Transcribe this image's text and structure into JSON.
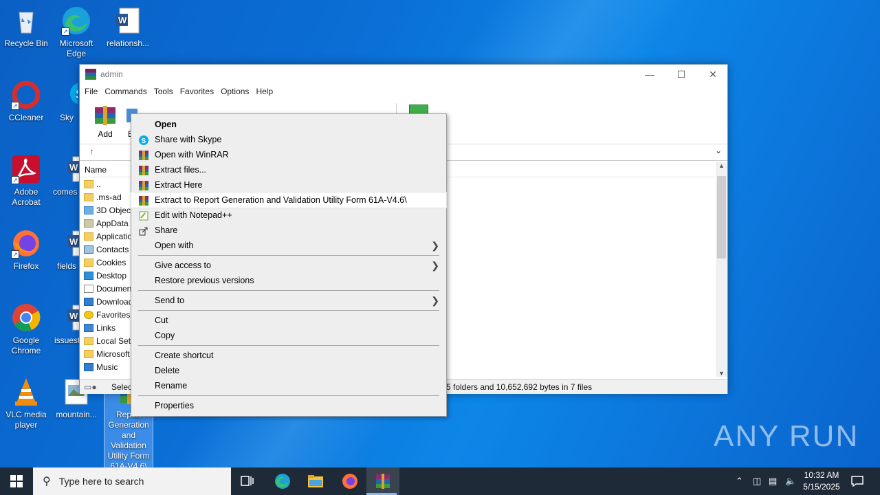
{
  "desktop": {
    "icons": [
      {
        "label": "Recycle Bin",
        "icon": "recycle-bin-icon"
      },
      {
        "label": "Microsoft Edge",
        "icon": "edge-icon"
      },
      {
        "label": "relationsh...",
        "icon": "word-doc-icon"
      },
      {
        "label": "CCleaner",
        "icon": "ccleaner-icon"
      },
      {
        "label": "Sky",
        "icon": "skype-icon"
      },
      {
        "label": "Adobe Acrobat",
        "icon": "acrobat-icon"
      },
      {
        "label": "comes",
        "icon": "word-doc-icon"
      },
      {
        "label": "Firefox",
        "icon": "firefox-icon"
      },
      {
        "label": "fields",
        "icon": "word-doc-icon"
      },
      {
        "label": "Google Chrome",
        "icon": "chrome-icon"
      },
      {
        "label": "issuest",
        "icon": "word-doc-icon"
      },
      {
        "label": "VLC media player",
        "icon": "vlc-icon"
      },
      {
        "label": "mountain...",
        "icon": "image-file-icon"
      },
      {
        "label": "Report Generation and Validation Utility Form 61A-V4.6\\",
        "icon": "rar-archive-icon"
      }
    ]
  },
  "window": {
    "title": "admin",
    "menu": [
      "File",
      "Commands",
      "Tools",
      "Favorites",
      "Options",
      "Help"
    ],
    "toolbar": [
      {
        "label": "Add",
        "icon": "add-archive-icon"
      },
      {
        "label": "E",
        "icon": "extract-to-icon"
      }
    ],
    "column_name": "Name",
    "files": [
      {
        "name": "..",
        "icon": "folder-up-icon"
      },
      {
        "name": ".ms-ad",
        "icon": "folder-icon"
      },
      {
        "name": "3D Object",
        "icon": "3d-objects-icon"
      },
      {
        "name": "AppData",
        "icon": "folder-icon"
      },
      {
        "name": "Applicatio",
        "icon": "folder-icon"
      },
      {
        "name": "Contacts",
        "icon": "contacts-icon"
      },
      {
        "name": "Cookies",
        "icon": "folder-icon"
      },
      {
        "name": "Desktop",
        "icon": "desktop-folder-icon"
      },
      {
        "name": "Documen",
        "icon": "documents-icon"
      },
      {
        "name": "Download",
        "icon": "downloads-icon"
      },
      {
        "name": "Favorites",
        "icon": "favorites-icon"
      },
      {
        "name": "Links",
        "icon": "links-icon"
      },
      {
        "name": "Local Sett",
        "icon": "folder-icon"
      },
      {
        "name": "Microsoft",
        "icon": "folder-icon"
      },
      {
        "name": "Music",
        "icon": "music-icon"
      }
    ],
    "status_left": "Select",
    "status_right": "5 folders and 10,652,692 bytes in 7 files"
  },
  "context_menu": {
    "items": [
      {
        "type": "item",
        "label": "Open",
        "bold": true
      },
      {
        "type": "item",
        "label": "Share with Skype",
        "icon": "skype-icon"
      },
      {
        "type": "item",
        "label": "Open with WinRAR",
        "icon": "winrar-icon"
      },
      {
        "type": "item",
        "label": "Extract files...",
        "icon": "winrar-icon"
      },
      {
        "type": "item",
        "label": "Extract Here",
        "icon": "winrar-icon"
      },
      {
        "type": "item",
        "label": "Extract to Report Generation and Validation Utility Form 61A-V4.6\\",
        "icon": "winrar-icon",
        "highlighted": true
      },
      {
        "type": "item",
        "label": "Edit with Notepad++",
        "icon": "notepadpp-icon"
      },
      {
        "type": "item",
        "label": "Share",
        "icon": "share-icon"
      },
      {
        "type": "item",
        "label": "Open with",
        "submenu": true
      },
      {
        "type": "sep"
      },
      {
        "type": "item",
        "label": "Give access to",
        "submenu": true
      },
      {
        "type": "item",
        "label": "Restore previous versions"
      },
      {
        "type": "sep"
      },
      {
        "type": "item",
        "label": "Send to",
        "submenu": true
      },
      {
        "type": "sep"
      },
      {
        "type": "item",
        "label": "Cut"
      },
      {
        "type": "item",
        "label": "Copy"
      },
      {
        "type": "sep"
      },
      {
        "type": "item",
        "label": "Create shortcut"
      },
      {
        "type": "item",
        "label": "Delete"
      },
      {
        "type": "item",
        "label": "Rename"
      },
      {
        "type": "sep"
      },
      {
        "type": "item",
        "label": "Properties"
      }
    ]
  },
  "taskbar": {
    "search_placeholder": "Type here to search",
    "time": "10:32 AM",
    "date": "5/15/2025"
  },
  "watermark": "ANY RUN"
}
